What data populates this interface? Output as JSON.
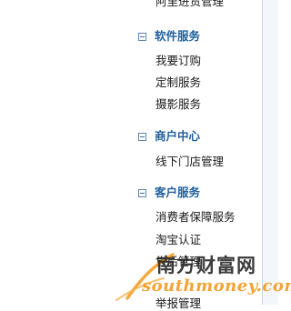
{
  "sidebar": {
    "top_item_cut": "阿里进货管理",
    "sections": [
      {
        "title": "软件服务",
        "items": [
          "我要订购",
          "定制服务",
          "摄影服务"
        ]
      },
      {
        "title": "商户中心",
        "items": [
          "线下门店管理"
        ]
      },
      {
        "title": "客户服务",
        "items": [
          "消费者保障服务",
          "淘宝认证",
          "售后管理"
        ]
      }
    ],
    "bottom_item_cut": "举报管理"
  },
  "watermark": {
    "cn": "南方财富网",
    "en": "southmoney.com"
  },
  "colors": {
    "section_title": "#1f5f9e",
    "item_text": "#1a1a1a",
    "toggle_border": "#5b86b0",
    "watermark_orange": "#f39a1f"
  }
}
